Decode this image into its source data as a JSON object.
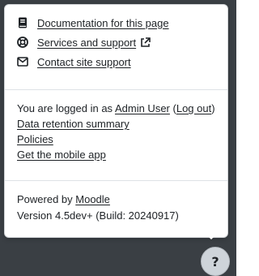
{
  "popover": {
    "links": [
      {
        "label": "Documentation for this page",
        "icon": "book-icon",
        "external": false
      },
      {
        "label": "Services and support",
        "icon": "lifebuoy-icon",
        "external": true
      },
      {
        "label": "Contact site support",
        "icon": "envelope-icon",
        "external": false
      }
    ],
    "account": {
      "logged_in_prefix": "You are logged in as ",
      "user_name": "Admin User",
      "logout_open": " (",
      "logout_label": "Log out",
      "logout_close": ")",
      "data_retention_label": "Data retention summary",
      "policies_label": "Policies",
      "mobile_app_label": "Get the mobile app"
    },
    "footer": {
      "powered_by_prefix": "Powered by ",
      "moodle_label": "Moodle",
      "version_text": "Version 4.5dev+ (Build: 20240917)"
    }
  },
  "help_button": {
    "label": "?"
  },
  "colors": {
    "backdrop": "#3a3f44",
    "popover_bg": "#ffffff",
    "text": "#1d2125",
    "divider": "#dee2e6",
    "help_button_bg": "#ced4da"
  }
}
